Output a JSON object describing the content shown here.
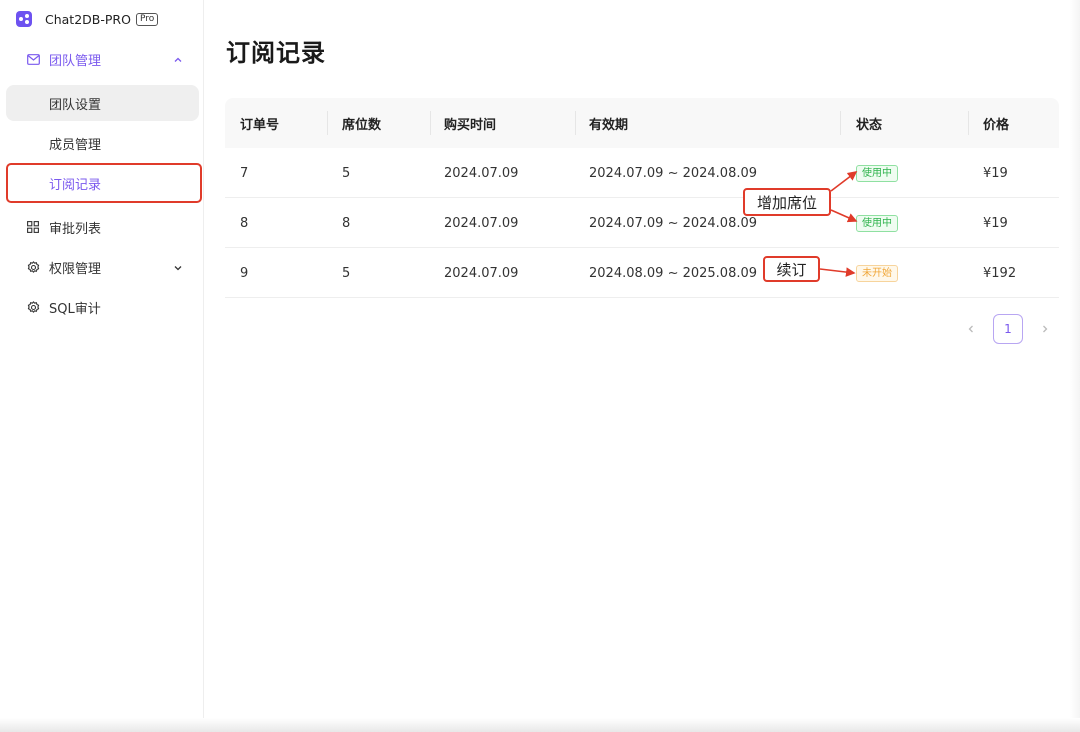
{
  "app": {
    "name": "Chat2DB-PRO",
    "badge": "Pro"
  },
  "sidebar": {
    "team_group": {
      "label": "团队管理",
      "icon": "mail-icon",
      "expanded": true
    },
    "team_sub": [
      {
        "label": "团队设置"
      },
      {
        "label": "成员管理"
      },
      {
        "label": "订阅记录"
      }
    ],
    "items": [
      {
        "label": "审批列表",
        "icon": "grid-icon"
      },
      {
        "label": "权限管理",
        "icon": "gear-icon"
      },
      {
        "label": "SQL审计",
        "icon": "gear-icon"
      }
    ]
  },
  "main": {
    "title": "订阅记录",
    "table": {
      "headers": [
        "订单号",
        "席位数",
        "购买时间",
        "有效期",
        "状态",
        "价格"
      ],
      "rows": [
        {
          "order": "7",
          "seats": "5",
          "purchased": "2024.07.09",
          "valid": "2024.07.09 ~ 2024.08.09",
          "status": "使用中",
          "status_color": "#2eb34c",
          "price": "¥19"
        },
        {
          "order": "8",
          "seats": "8",
          "purchased": "2024.07.09",
          "valid": "2024.07.09 ~ 2024.08.09",
          "status": "使用中",
          "status_color": "#2eb34c",
          "price": "¥19"
        },
        {
          "order": "9",
          "seats": "5",
          "purchased": "2024.07.09",
          "valid": "2024.08.09 ~ 2025.08.09",
          "status": "未开始",
          "status_color": "#f0a73a",
          "price": "¥192"
        }
      ]
    },
    "pagination": {
      "current": "1"
    },
    "annotations": {
      "add_seats": "增加席位",
      "renew": "续订"
    }
  },
  "colors": {
    "accent": "#7a59ee",
    "annotation": "#e03b2a"
  }
}
